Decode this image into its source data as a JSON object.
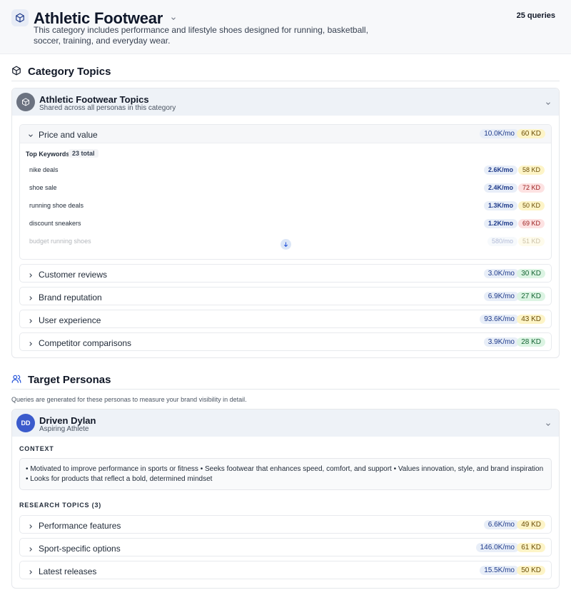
{
  "header": {
    "title": "Athletic Footwear",
    "description": "This category includes performance and lifestyle shoes designed for running, basketball, soccer, training, and everyday wear.",
    "query_count": "25 queries",
    "icon": "box-icon"
  },
  "category_topics": {
    "section_title": "Category Topics",
    "card": {
      "name": "Athletic Footwear Topics",
      "subtitle": "Shared across all personas in this category"
    },
    "expanded_topic": {
      "label": "Price and value",
      "volume": "10.0K/mo",
      "kd": "60 KD",
      "kd_level": "yellow",
      "keywords_header": "Top Keywords",
      "keywords_total": "23 total",
      "keywords": [
        {
          "name": "nike deals",
          "volume": "2.6K/mo",
          "kd": "58 KD",
          "kd_level": "yellow"
        },
        {
          "name": "shoe sale",
          "volume": "2.4K/mo",
          "kd": "72 KD",
          "kd_level": "red"
        },
        {
          "name": "running shoe deals",
          "volume": "1.3K/mo",
          "kd": "50 KD",
          "kd_level": "yellow"
        },
        {
          "name": "discount sneakers",
          "volume": "1.2K/mo",
          "kd": "69 KD",
          "kd_level": "red"
        },
        {
          "name": "budget running shoes",
          "volume": "580/mo",
          "kd": "51 KD",
          "kd_level": "yellow"
        }
      ]
    },
    "topics": [
      {
        "label": "Customer reviews",
        "volume": "3.0K/mo",
        "kd": "30 KD",
        "kd_level": "green"
      },
      {
        "label": "Brand reputation",
        "volume": "6.9K/mo",
        "kd": "27 KD",
        "kd_level": "green"
      },
      {
        "label": "User experience",
        "volume": "93.6K/mo",
        "kd": "43 KD",
        "kd_level": "yellow"
      },
      {
        "label": "Competitor comparisons",
        "volume": "3.9K/mo",
        "kd": "28 KD",
        "kd_level": "green"
      }
    ]
  },
  "target_personas": {
    "section_title": "Target Personas",
    "description": "Queries are generated for these personas to measure your brand visibility in detail.",
    "persona": {
      "initials": "DD",
      "name": "Driven Dylan",
      "role": "Aspiring Athlete",
      "context_label": "CONTEXT",
      "context": "• Motivated to improve performance in sports or fitness • Seeks footwear that enhances speed, comfort, and support • Values innovation, style, and brand inspiration • Looks for products that reflect a bold, determined mindset",
      "research_label": "RESEARCH TOPICS (3)",
      "research_topics": [
        {
          "label": "Performance features",
          "volume": "6.6K/mo",
          "kd": "49 KD",
          "kd_level": "yellow"
        },
        {
          "label": "Sport-specific options",
          "volume": "146.0K/mo",
          "kd": "61 KD",
          "kd_level": "yellow"
        },
        {
          "label": "Latest releases",
          "volume": "15.5K/mo",
          "kd": "50 KD",
          "kd_level": "yellow"
        }
      ]
    }
  },
  "colors": {
    "accent": "#1d4ed8",
    "persona_avatar": "#3b5bcc",
    "kd_green": "#dcf4e3",
    "kd_yellow": "#fdf4c7",
    "kd_red": "#fde2e2"
  }
}
